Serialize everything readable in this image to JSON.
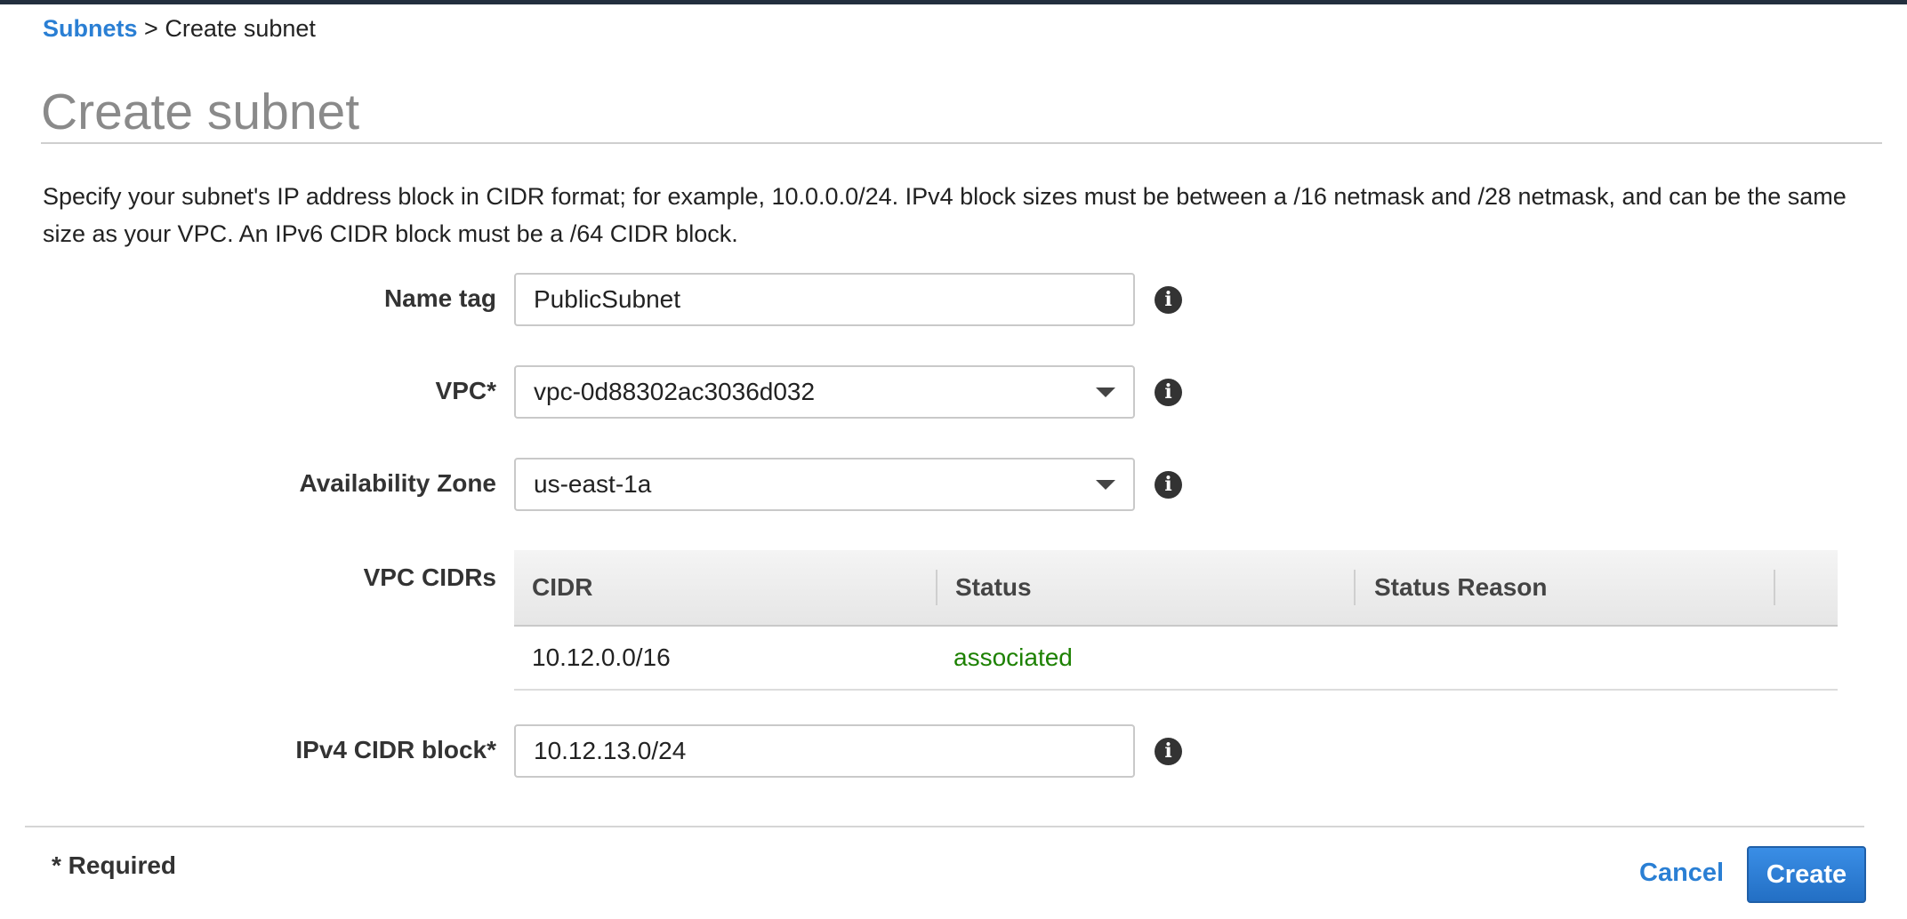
{
  "breadcrumb": {
    "link": "Subnets",
    "separator": ">",
    "current": "Create subnet"
  },
  "page": {
    "title": "Create subnet",
    "description": "Specify your subnet's IP address block in CIDR format; for example, 10.0.0.0/24. IPv4 block sizes must be between a /16 netmask and /28 netmask, and can be the same size as your VPC. An IPv6 CIDR block must be a /64 CIDR block."
  },
  "form": {
    "name_tag": {
      "label": "Name tag",
      "value": "PublicSubnet"
    },
    "vpc": {
      "label": "VPC*",
      "value": "vpc-0d88302ac3036d032"
    },
    "availability_zone": {
      "label": "Availability Zone",
      "value": "us-east-1a"
    },
    "vpc_cidrs": {
      "label": "VPC CIDRs",
      "columns": [
        "CIDR",
        "Status",
        "Status Reason"
      ],
      "rows": [
        {
          "cidr": "10.12.0.0/16",
          "status": "associated",
          "status_reason": ""
        }
      ]
    },
    "ipv4_cidr_block": {
      "label": "IPv4 CIDR block*",
      "value": "10.12.13.0/24"
    },
    "info_glyph": "i"
  },
  "footer": {
    "required_note": "* Required",
    "cancel_label": "Cancel",
    "create_label": "Create"
  },
  "colors": {
    "link": "#2a7fd4",
    "status_ok": "#1d8102",
    "primary_button": "#236fc4",
    "title": "#8a8a8a"
  },
  "icons": {
    "info": "info-circle-icon",
    "dropdown": "caret-down-icon"
  }
}
